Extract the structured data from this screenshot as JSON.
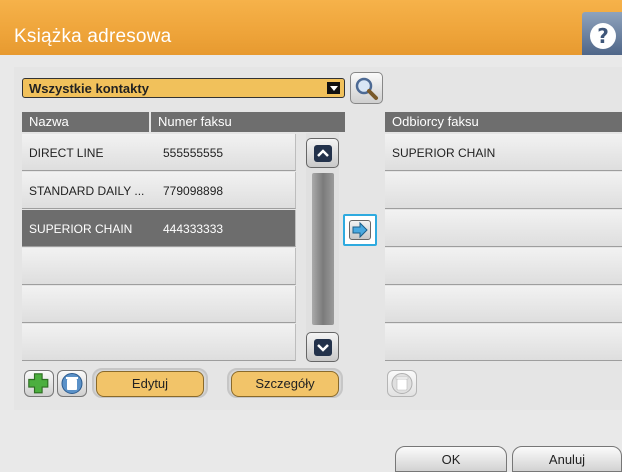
{
  "title": "Książka adresowa",
  "help_glyph": "?",
  "filter": {
    "selected": "Wszystkie kontakty"
  },
  "contacts": {
    "headers": {
      "name": "Nazwa",
      "fax": "Numer faksu"
    },
    "rows": [
      {
        "name": "DIRECT LINE",
        "fax": "555555555",
        "selected": false
      },
      {
        "name": "STANDARD DAILY ...",
        "fax": "779098898",
        "selected": false
      },
      {
        "name": "SUPERIOR CHAIN",
        "fax": "444333333",
        "selected": true
      },
      {
        "name": "",
        "fax": "",
        "selected": false
      },
      {
        "name": "",
        "fax": "",
        "selected": false
      },
      {
        "name": "",
        "fax": "",
        "selected": false
      }
    ]
  },
  "recipients": {
    "header": "Odbiorcy faksu",
    "rows": [
      "SUPERIOR CHAIN",
      "",
      "",
      "",
      "",
      ""
    ]
  },
  "buttons": {
    "edit": "Edytuj",
    "details": "Szczegóły",
    "ok": "OK",
    "cancel": "Anuluj"
  },
  "icons": {
    "help": "question-icon",
    "search": "magnifier-icon",
    "scroll_up": "chevron-up-icon",
    "scroll_down": "chevron-down-icon",
    "move": "arrow-right-icon",
    "add": "plus-icon",
    "delete": "trash-icon"
  },
  "colors": {
    "title_bar": "#eea43a",
    "accent_yellow": "#f2c469",
    "selection": "#2eaadf",
    "add_green": "#4caf3f",
    "header_gray": "#6e6e6e"
  }
}
